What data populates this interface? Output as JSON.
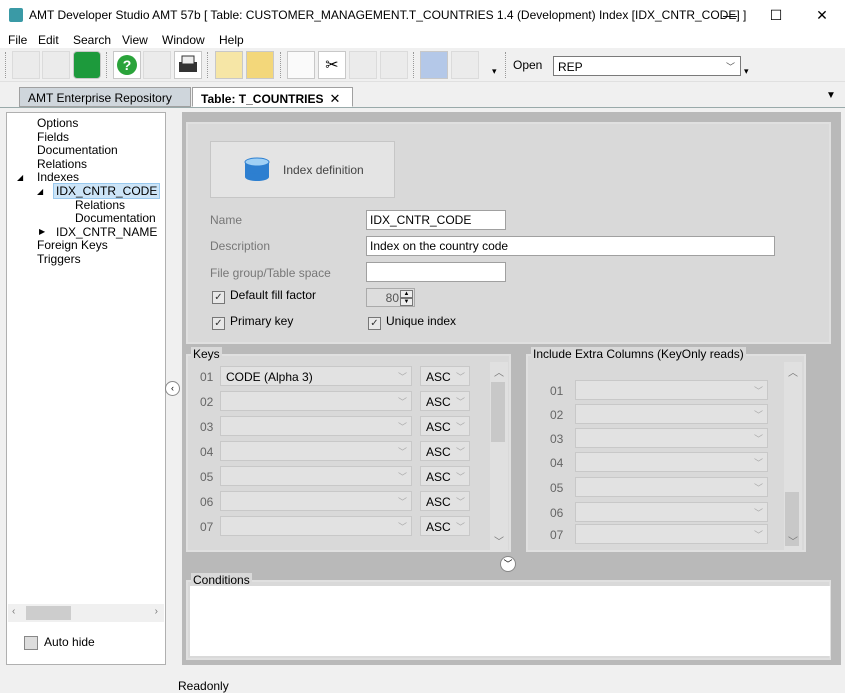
{
  "window": {
    "title": "AMT Developer Studio AMT 57b  [ Table: CUSTOMER_MANAGEMENT.T_COUNTRIES 1.4 (Development) Index [IDX_CNTR_CODE] ]",
    "minimize": "—",
    "maximize": "☐",
    "close": "✕"
  },
  "menu": [
    "File",
    "Edit",
    "Search",
    "View",
    "Window",
    "Help"
  ],
  "toolbar": {
    "open_label": "Open",
    "open_value": "REP"
  },
  "tabs": [
    {
      "label": "AMT Enterprise Repository"
    },
    {
      "label": "Table: T_COUNTRIES"
    }
  ],
  "tab_close": "✕",
  "tree": {
    "items": [
      "Options",
      "Fields",
      "Documentation",
      "Relations",
      "Indexes",
      "IDX_CNTR_CODE",
      "Relations",
      "Documentation",
      "IDX_CNTR_NAME",
      "Foreign Keys",
      "Triggers"
    ],
    "auto_hide": "Auto hide"
  },
  "index": {
    "definition_button": "Index definition",
    "name_label": "Name",
    "name_value": "IDX_CNTR_CODE",
    "description_label": "Description",
    "description_value": "Index on the country code",
    "filegroup_label": "File group/Table space",
    "filegroup_value": "",
    "default_fill_factor_label": "Default fill factor",
    "fill_factor_value": "80",
    "primary_key_label": "Primary key",
    "unique_index_label": "Unique index"
  },
  "keys": {
    "title": "Keys",
    "rows": [
      {
        "num": "01",
        "column": "CODE (Alpha 3)",
        "order": "ASC"
      },
      {
        "num": "02",
        "column": "",
        "order": "ASC"
      },
      {
        "num": "03",
        "column": "",
        "order": "ASC"
      },
      {
        "num": "04",
        "column": "",
        "order": "ASC"
      },
      {
        "num": "05",
        "column": "",
        "order": "ASC"
      },
      {
        "num": "06",
        "column": "",
        "order": "ASC"
      },
      {
        "num": "07",
        "column": "",
        "order": "ASC"
      }
    ]
  },
  "extra": {
    "title": "Include Extra Columns (KeyOnly reads)",
    "rows": [
      "01",
      "02",
      "03",
      "04",
      "05",
      "06",
      "07"
    ]
  },
  "conditions": {
    "title": "Conditions"
  },
  "status": {
    "text": "Readonly"
  }
}
